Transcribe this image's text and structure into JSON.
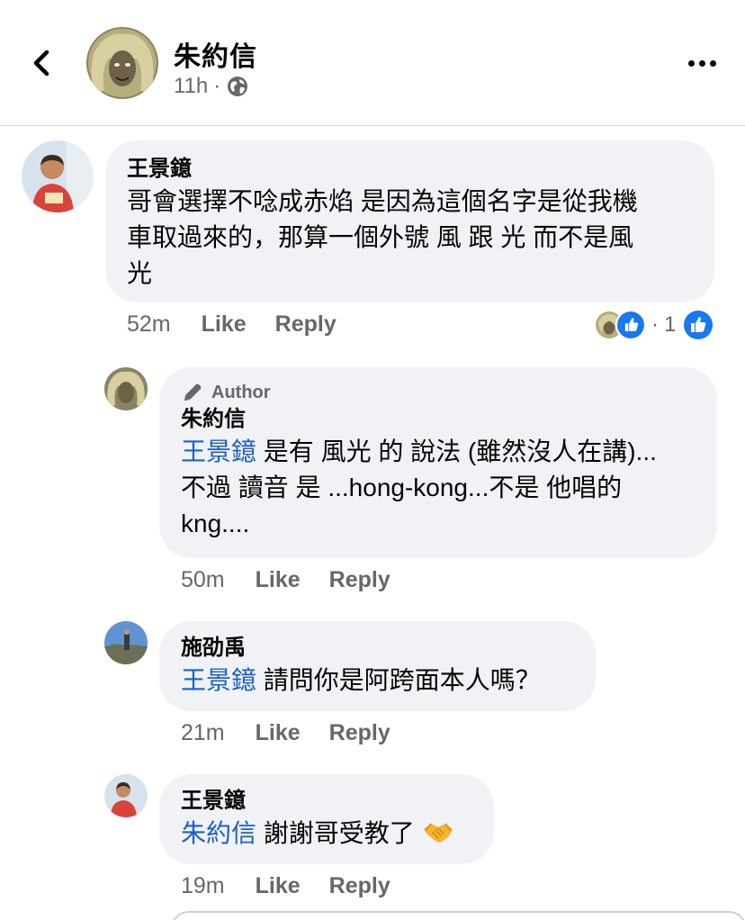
{
  "header": {
    "name": "朱約信",
    "time": "11h",
    "separator": "·",
    "privacy_icon": "globe-icon",
    "back_icon": "chevron-left-icon",
    "more_icon": "more-horizontal-icon"
  },
  "colors": {
    "mention": "#1c60c7",
    "bubble_bg": "#f0f2f5",
    "secondary_text": "#65676b",
    "like_blue": "#1877f2"
  },
  "comments": [
    {
      "name": "王景鐿",
      "text": "哥會選擇不唸成赤焰 是因為這個名字是從我機車取過來的，那算一個外號 風  跟 光  而不是風光",
      "text_lines": [
        "哥會選擇不唸成赤焰 是因為這個名字是從我機",
        "車取過來的，那算一個外號 風  跟 光  而不是風",
        "光"
      ],
      "time": "52m",
      "like": "Like",
      "reply": "Reply",
      "reaction_separator": "·",
      "reaction_count": "1"
    },
    {
      "badge": "Author",
      "badge_icon": "pen-icon",
      "name": "朱約信",
      "mention": "王景鐿",
      "text_lines": [
        " 是有 風光 的 說法 (雖然沒人在講)...",
        "不過 讀音 是 ...hong-kong...不是 他唱的",
        "kng...."
      ],
      "time": "50m",
      "like": "Like",
      "reply": "Reply"
    },
    {
      "name": "施劭禹",
      "mention": "王景鐿",
      "text": " 請問你是阿跨面本人嗎？",
      "time": "21m",
      "like": "Like",
      "reply": "Reply"
    },
    {
      "name": "王景鐿",
      "mention": "朱約信",
      "text": " 謝謝哥受教了",
      "emoji": "handshake-emoji",
      "time": "19m",
      "like": "Like",
      "reply": "Reply"
    }
  ]
}
